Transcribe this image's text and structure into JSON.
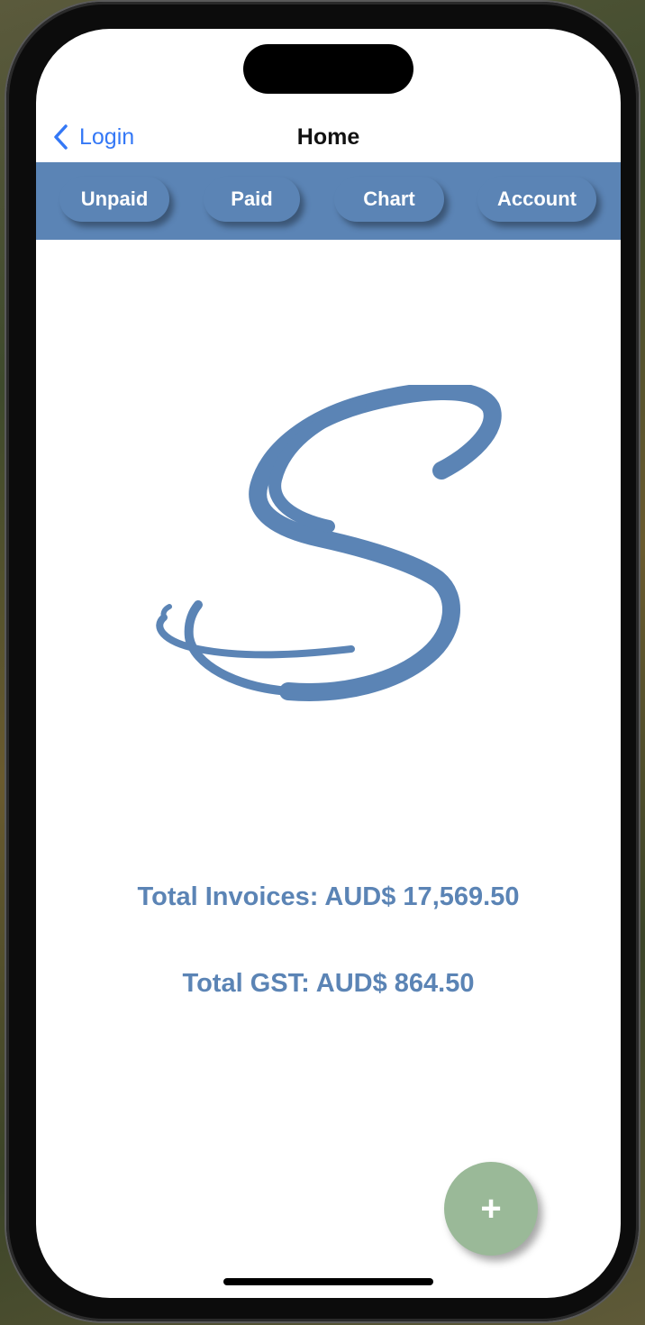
{
  "nav": {
    "back_label": "Login",
    "title": "Home"
  },
  "tabs": [
    {
      "label": "Unpaid"
    },
    {
      "label": "Paid"
    },
    {
      "label": "Chart"
    },
    {
      "label": "Account"
    }
  ],
  "logo": {
    "letter": "S",
    "color": "#5b84b5"
  },
  "totals": {
    "invoices": "Total Invoices: AUD$ 17,569.50",
    "gst": "Total GST: AUD$ 864.50"
  },
  "fab": {
    "label": "+",
    "icon": "plus-icon",
    "color": "#9ab998"
  },
  "colors": {
    "accent": "#5b84b5",
    "link": "#3478f6"
  }
}
